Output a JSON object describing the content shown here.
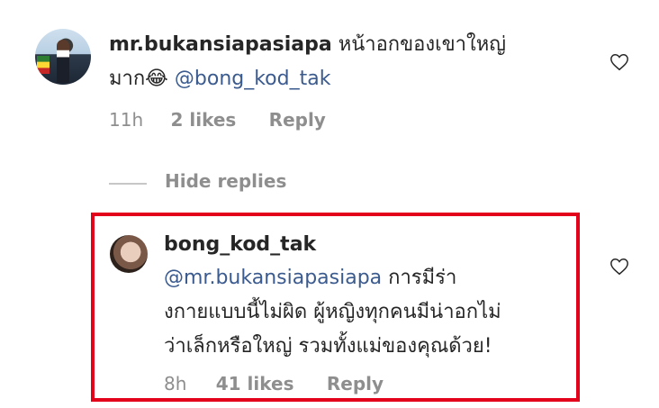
{
  "comment": {
    "username": "mr.bukansiapasiapa",
    "text_line1": "หน้าอกของเขาใหญ่",
    "text_line2": "มาก😂",
    "mention": "@bong_kod_tak",
    "time": "11h",
    "likes": "2 likes",
    "reply_label": "Reply",
    "like_icon": "heart-outline-icon"
  },
  "hide_replies_label": "Hide replies",
  "reply": {
    "username": "bong_kod_tak",
    "mention": "@mr.bukansiapasiapa",
    "text_line1_rest": " การมีร่า",
    "text_line2": "งกายแบบนี้ไม่ผิด ผู้หญิงทุกคนมีน่าอกไม่",
    "text_line3": "ว่าเล็กหรือใหญ่ รวมทั้งแม่ของคุณด้วย!",
    "time": "8h",
    "likes": "41 likes",
    "reply_label": "Reply",
    "like_icon": "heart-outline-icon"
  },
  "colors": {
    "highlight_border": "#e3001b",
    "mention": "#3b5b8f",
    "meta_gray": "#8e8e8e"
  }
}
